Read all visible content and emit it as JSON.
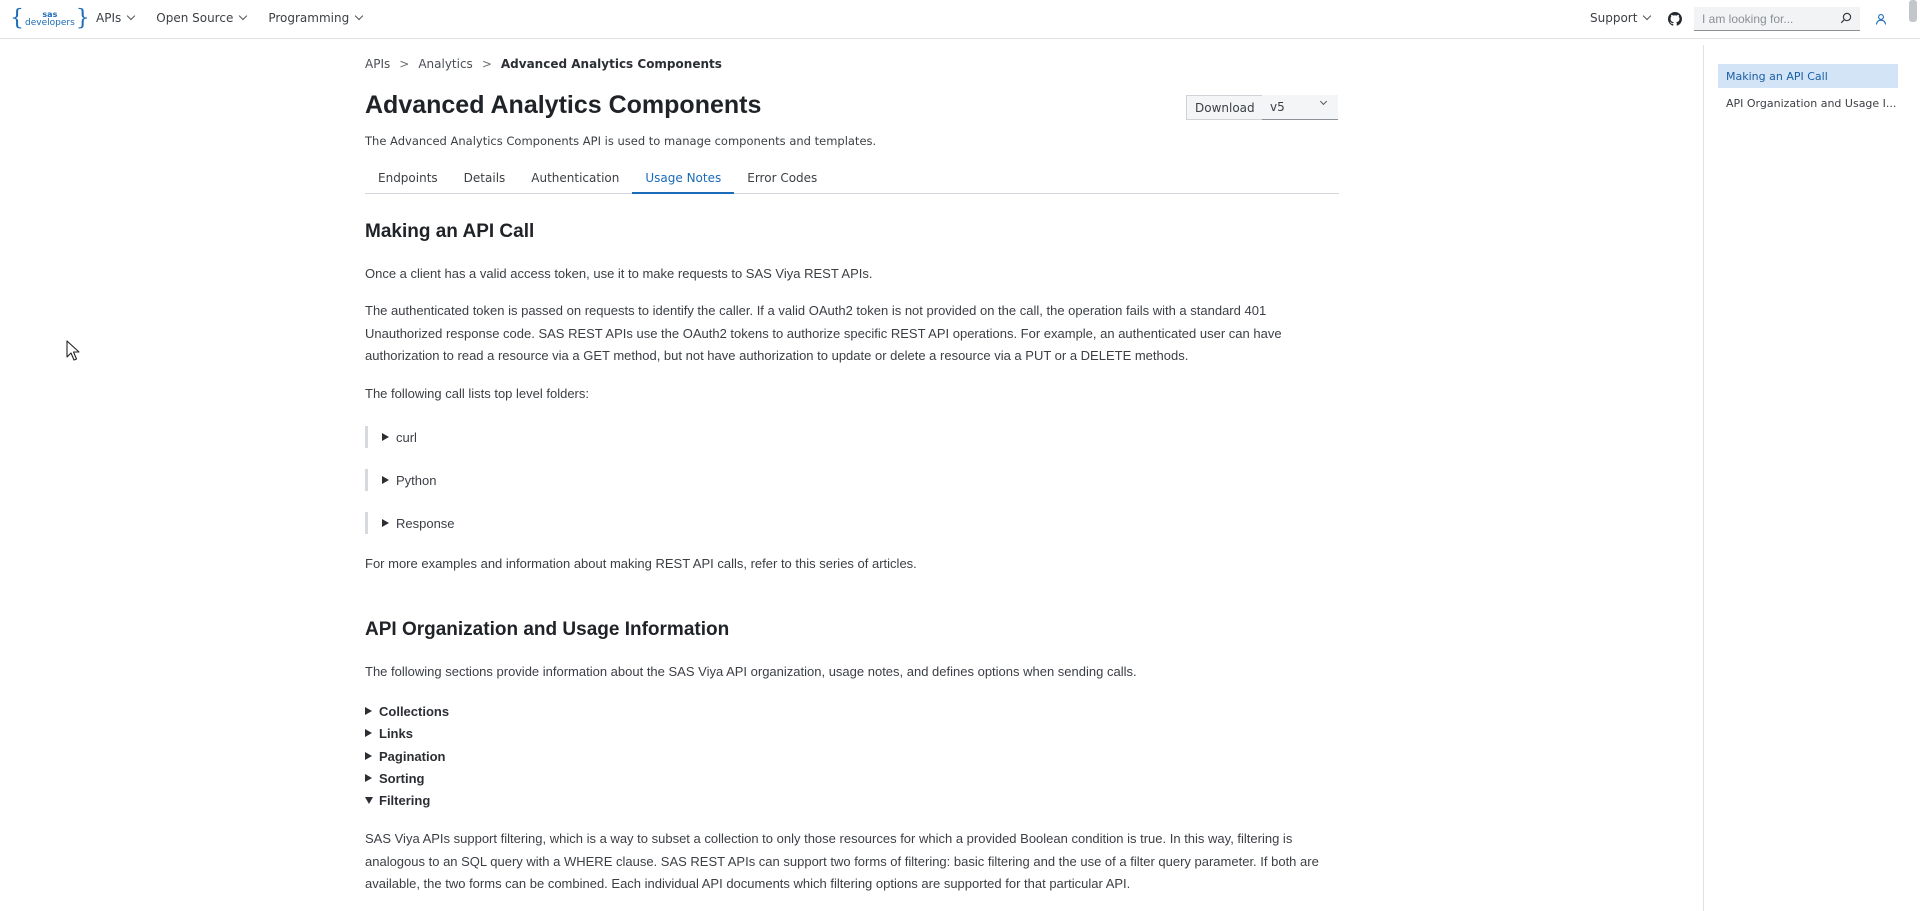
{
  "nav": {
    "logo_top": "sas",
    "logo_bottom": "developers",
    "menu": [
      {
        "label": "APIs"
      },
      {
        "label": "Open Source"
      },
      {
        "label": "Programming"
      }
    ],
    "support": "Support",
    "search_placeholder": "I am looking for..."
  },
  "breadcrumb": [
    "APIs",
    "Analytics",
    "Advanced Analytics Components"
  ],
  "page": {
    "title": "Advanced Analytics Components",
    "download_label": "Download",
    "version": "v5",
    "subtitle": "The Advanced Analytics Components API is used to manage components and templates."
  },
  "tabs": [
    "Endpoints",
    "Details",
    "Authentication",
    "Usage Notes",
    "Error Codes"
  ],
  "active_tab": "Usage Notes",
  "making_call": {
    "heading": "Making an API Call",
    "p1": "Once a client has a valid access token, use it to make requests to SAS Viya REST APIs.",
    "p2": "The authenticated token is passed on requests to identify the caller. If a valid OAuth2 token is not provided on the call, the operation fails with a standard 401 Unauthorized response code. SAS REST APIs use the OAuth2 tokens to authorize specific REST API operations. For example, an authenticated user can have authorization to read a resource via a GET method, but not have authorization to update or delete a resource via a PUT or a DELETE methods.",
    "p3": "The following call lists top level folders:",
    "collapsibles": [
      "curl",
      "Python",
      "Response"
    ],
    "p4_prefix": "For more examples and information about making REST API calls, refer to ",
    "p4_link": "this series of articles",
    "p4_suffix": "."
  },
  "organization": {
    "heading": "API Organization and Usage Information",
    "intro": "The following sections provide information about the SAS Viya API organization, usage notes, and defines options when sending calls.",
    "sections": [
      "Collections",
      "Links",
      "Pagination",
      "Sorting",
      "Filtering"
    ],
    "filtering_text": "SAS Viya APIs support filtering, which is a way to subset a collection to only those resources for which a provided Boolean condition is true. In this way, filtering is analogous to an SQL query with a WHERE clause. SAS REST APIs can support two forms of filtering: basic filtering and the use of a filter query parameter. If both are available, the two forms can be combined. Each individual API documents which filtering options are supported for that particular API."
  },
  "toc": [
    "Making an API Call",
    "API Organization and Usage I..."
  ],
  "colors": {
    "accent": "#1b6bb8",
    "toc_active_bg": "#d3e4f7"
  }
}
